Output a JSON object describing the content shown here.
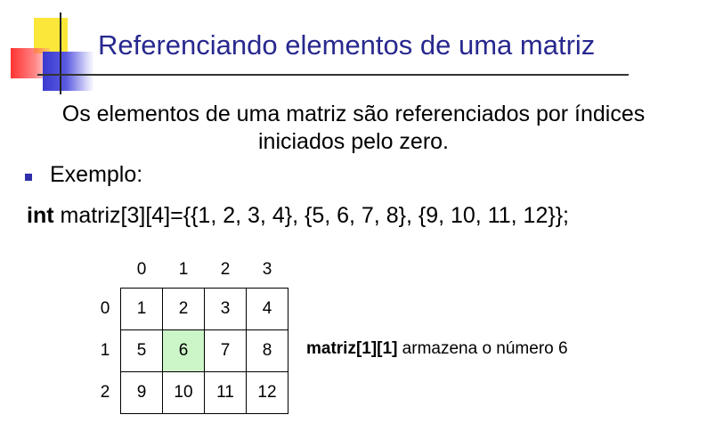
{
  "slide": {
    "title": "Referenciando elementos de uma matriz",
    "intro_line1": "Os elementos de uma matriz são referenciados por índices",
    "intro_line2": "iniciados pelo zero.",
    "bullet": "Exemplo:",
    "code_keyword": "int",
    "code_rest": " matriz[3][4]={{1, 2, 3, 4}, {5, 6, 7, 8}, {9, 10, 11, 12}};"
  },
  "matrix": {
    "column_indices": [
      "0",
      "1",
      "2",
      "3"
    ],
    "row_indices": [
      "0",
      "1",
      "2"
    ],
    "rows": [
      [
        "1",
        "2",
        "3",
        "4"
      ],
      [
        "5",
        "6",
        "7",
        "8"
      ],
      [
        "9",
        "10",
        "11",
        "12"
      ]
    ],
    "highlight_color": "#ccf5c8"
  },
  "caption": {
    "bold": "matriz[1][1]",
    "rest": " armazena o número 6"
  },
  "colors": {
    "title": "#28288f",
    "bullet": "#2e2eaa"
  }
}
